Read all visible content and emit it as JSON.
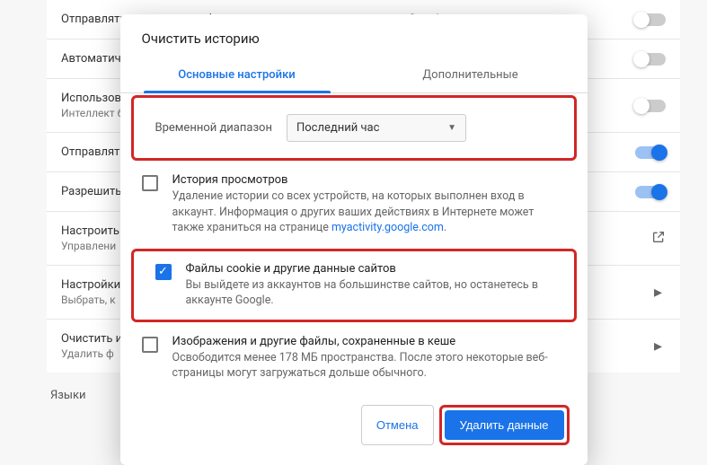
{
  "bg": {
    "rows": [
      {
        "title": "Отправлять системную информацию и содержимое страниц в Google",
        "sub": "",
        "ctrl": "toggle",
        "on": false
      },
      {
        "title": "Автоматич",
        "sub": "",
        "ctrl": "toggle",
        "on": false
      },
      {
        "title": "Использов",
        "sub": "Интеллект\nбраузере,",
        "ctrl": "toggle",
        "on": false
      },
      {
        "title": "Отправлять",
        "sub": "",
        "ctrl": "toggle",
        "on": true
      },
      {
        "title": "Разрешить",
        "sub": "",
        "ctrl": "toggle",
        "on": true
      },
      {
        "title": "Настроить",
        "sub": "Управлени",
        "ctrl": "open",
        "on": false
      },
      {
        "title": "Настройки",
        "sub": "Выбрать, к",
        "ctrl": "chev",
        "on": false
      },
      {
        "title": "Очистить и",
        "sub": "Удалить ф",
        "ctrl": "chev",
        "on": false
      }
    ],
    "section": "Языки"
  },
  "modal": {
    "title": "Очистить историю",
    "tabs": {
      "basic": "Основные настройки",
      "advanced": "Дополнительные"
    },
    "range": {
      "label": "Временной диапазон",
      "value": "Последний час"
    },
    "items": [
      {
        "checked": false,
        "title": "История просмотров",
        "desc_pre": "Удаление истории со всех устройств, на которых выполнен вход в аккаунт. Информация о других ваших действиях в Интернете может также храниться на странице ",
        "link": "myactivity.google.com",
        "desc_post": "."
      },
      {
        "checked": true,
        "title": "Файлы cookie и другие данные сайтов",
        "desc_pre": "Вы выйдете из аккаунтов на большинстве сайтов, но останетесь в аккаунте Google.",
        "link": "",
        "desc_post": ""
      },
      {
        "checked": false,
        "title": "Изображения и другие файлы, сохраненные в кеше",
        "desc_pre": "Освободится менее 178 МБ пространства. После этого некоторые веб-страницы могут загружаться дольше обычного.",
        "link": "",
        "desc_post": ""
      }
    ],
    "actions": {
      "cancel": "Отмена",
      "clear": "Удалить данные"
    }
  }
}
